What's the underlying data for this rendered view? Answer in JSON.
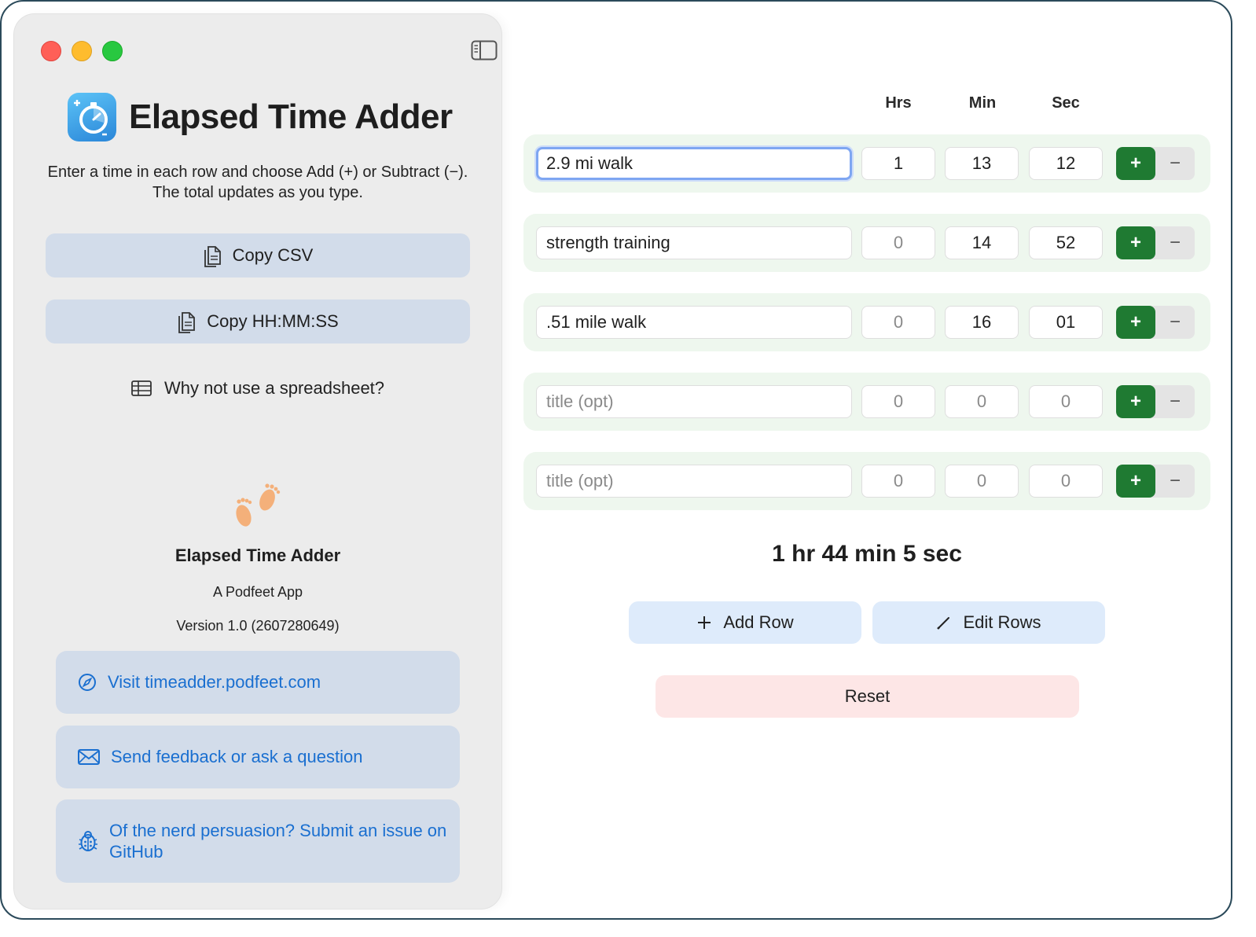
{
  "sidebar": {
    "app_title": "Elapsed Time Adder",
    "intro": "Enter a time in each row and choose Add (+) or Subtract (−). The total updates as you type.",
    "copy_csv_label": "Copy CSV",
    "copy_hms_label": "Copy HH:MM:SS",
    "why_label": "Why not use a spreadsheet?",
    "about": {
      "name": "Elapsed Time Adder",
      "subtitle": "A Podfeet App",
      "version": "Version 1.0 (2607280649)"
    },
    "links": [
      {
        "label": "Visit timeadder.podfeet.com",
        "icon": "compass-icon"
      },
      {
        "label": "Send feedback or ask a question",
        "icon": "envelope-icon"
      },
      {
        "label": "Of the nerd persuasion? Submit an issue on GitHub",
        "icon": "ladybug-icon"
      }
    ]
  },
  "table": {
    "headers": {
      "hrs": "Hrs",
      "min": "Min",
      "sec": "Sec"
    },
    "title_placeholder": "title (opt)",
    "plus_label": "+",
    "minus_label": "−",
    "rows": [
      {
        "title": "2.9 mi walk",
        "hrs": "1",
        "min": "13",
        "sec": "12",
        "mode": "add"
      },
      {
        "title": "strength training",
        "hrs": "0",
        "min": "14",
        "sec": "52",
        "mode": "add"
      },
      {
        "title": ".51 mile walk",
        "hrs": "0",
        "min": "16",
        "sec": "01",
        "mode": "add"
      },
      {
        "title": "",
        "hrs": "0",
        "min": "0",
        "sec": "0",
        "mode": "add"
      },
      {
        "title": "",
        "hrs": "0",
        "min": "0",
        "sec": "0",
        "mode": "add"
      }
    ]
  },
  "total": "1 hr 44 min 5 sec",
  "actions": {
    "add_row_label": "Add Row",
    "edit_rows_label": "Edit Rows",
    "reset_label": "Reset"
  },
  "colors": {
    "accent_green": "#1f7a32",
    "link_blue": "#1a6fd0",
    "row_bg": "#eef7ee",
    "reset_bg": "#fde6e6",
    "sidebar_button_bg": "#d2dcea"
  }
}
